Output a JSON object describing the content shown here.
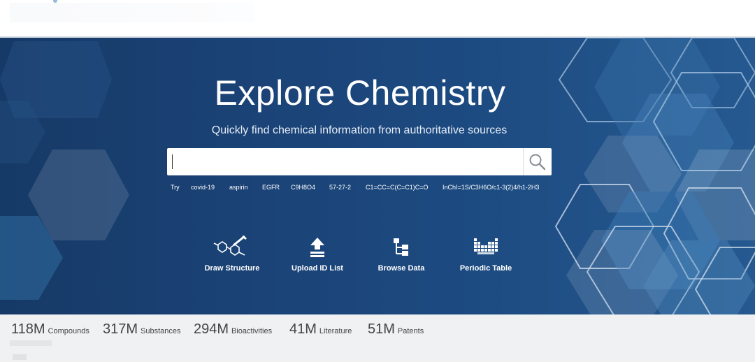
{
  "hero": {
    "title": "Explore Chemistry",
    "subtitle": "Quickly find chemical information from authoritative sources"
  },
  "search": {
    "value": "",
    "button_icon": "search-icon"
  },
  "try": {
    "label": "Try",
    "examples": [
      "covid-19",
      "aspirin",
      "EGFR",
      "C9H8O4",
      "57-27-2",
      "C1=CC=C(C=C1)C=O",
      "InChI=1S/C3H6O/c1-3(2)4/h1-2H3"
    ]
  },
  "actions": [
    {
      "label": "Draw Structure",
      "icon": "molecule-pencil-icon"
    },
    {
      "label": "Upload ID List",
      "icon": "upload-icon"
    },
    {
      "label": "Browse Data",
      "icon": "tree-icon"
    },
    {
      "label": "Periodic Table",
      "icon": "periodic-table-icon"
    }
  ],
  "stats": [
    {
      "number": "118M",
      "unit": "Compounds"
    },
    {
      "number": "317M",
      "unit": "Substances"
    },
    {
      "number": "294M",
      "unit": "Bioactivities"
    },
    {
      "number": "41M",
      "unit": "Literature"
    },
    {
      "number": "51M",
      "unit": "Patents"
    }
  ],
  "colors": {
    "hero_background": "#1b4377",
    "stats_background": "#f0f1f3",
    "text_on_hero": "#ffffff"
  }
}
